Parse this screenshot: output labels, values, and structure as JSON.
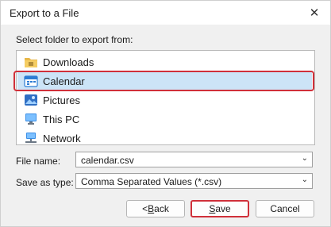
{
  "window": {
    "title": "Export to a File",
    "close_glyph": "✕"
  },
  "prompt": "Select folder to export from:",
  "folders": [
    {
      "label": "Downloads",
      "icon": "downloads-folder-icon"
    },
    {
      "label": "Calendar",
      "icon": "calendar-icon",
      "selected": true
    },
    {
      "label": "Pictures",
      "icon": "pictures-folder-icon"
    },
    {
      "label": "This PC",
      "icon": "computer-icon"
    },
    {
      "label": "Network",
      "icon": "network-icon"
    }
  ],
  "file_name": {
    "label": "File name:",
    "value": "calendar.csv"
  },
  "save_as_type": {
    "label": "Save as type:",
    "value": "Comma Separated Values (*.csv)"
  },
  "buttons": {
    "back": "< Back",
    "save": "Save",
    "cancel": "Cancel"
  },
  "colors": {
    "selection": "#cce4f7",
    "highlight_ring": "#d0303a"
  }
}
